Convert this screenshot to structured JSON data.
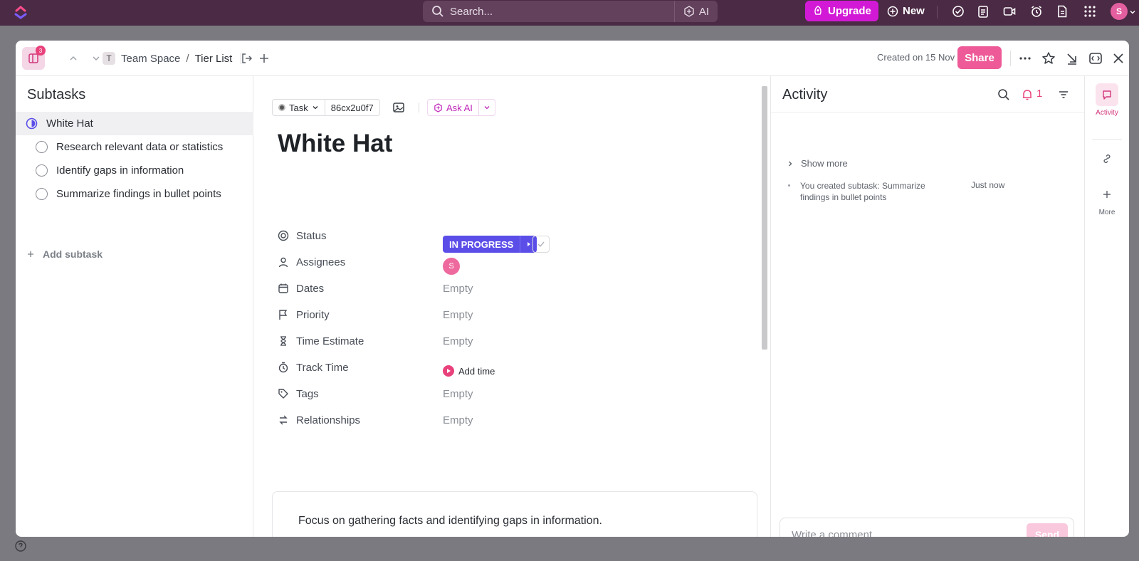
{
  "topbar": {
    "search_placeholder": "Search...",
    "ai_label": "AI",
    "upgrade_label": "Upgrade",
    "new_label": "New",
    "avatar_initial": "S"
  },
  "header": {
    "subtask_count": "3",
    "breadcrumb": {
      "space_initial": "T",
      "space": "Team Space",
      "separator": "/",
      "list": "Tier List"
    },
    "created": "Created on 15 Nov",
    "share_label": "Share"
  },
  "subtasks": {
    "title": "Subtasks",
    "items": [
      {
        "label": "White Hat",
        "active": true
      },
      {
        "label": "Research relevant data or statistics"
      },
      {
        "label": "Identify gaps in information"
      },
      {
        "label": "Summarize findings in bullet points"
      }
    ],
    "add_label": "Add subtask"
  },
  "task": {
    "type_label": "Task",
    "id": "86cx2u0f7",
    "ask_ai_label": "Ask AI",
    "title": "White Hat",
    "properties": [
      {
        "label": "Status",
        "icon": "status-icon"
      },
      {
        "label": "Assignees",
        "icon": "user-icon"
      },
      {
        "label": "Dates",
        "icon": "calendar-icon",
        "value": "Empty"
      },
      {
        "label": "Priority",
        "icon": "flag-icon",
        "value": "Empty"
      },
      {
        "label": "Time Estimate",
        "icon": "hourglass-icon",
        "value": "Empty"
      },
      {
        "label": "Track Time",
        "icon": "timer-icon"
      },
      {
        "label": "Tags",
        "icon": "tag-icon",
        "value": "Empty"
      },
      {
        "label": "Relationships",
        "icon": "relationship-icon",
        "value": "Empty"
      }
    ],
    "status_value": "IN PROGRESS",
    "assignee_initial": "S",
    "add_time_label": "Add time",
    "description": "Focus on gathering facts and identifying gaps in information."
  },
  "activity": {
    "title": "Activity",
    "bell_count": "1",
    "show_more": "Show more",
    "entries": [
      {
        "text": "You created subtask: Summarize findings in bullet points",
        "time": "Just now"
      }
    ],
    "comment_placeholder": "Write a comment...",
    "send_label": "Send"
  },
  "rail": {
    "activity_label": "Activity",
    "more_label": "More"
  },
  "colors": {
    "topbar": "#4b2a45",
    "upgrade": "#d21ad6",
    "share": "#ee5a97",
    "status": "#5b4ee8",
    "accent_pink": "#e8417b"
  }
}
